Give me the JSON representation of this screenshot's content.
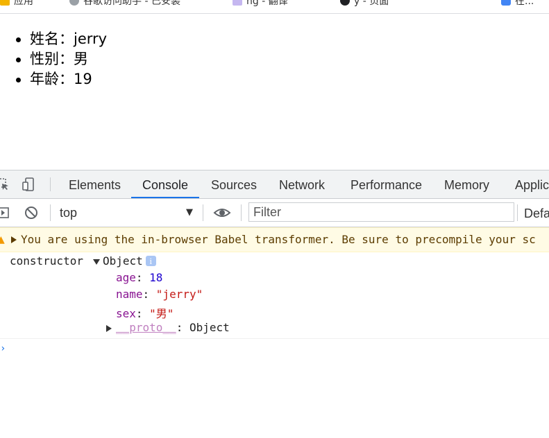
{
  "bookmarks": [
    {
      "label": "应用",
      "color": "#f4b400"
    },
    {
      "label": "谷歌访问助手 - 已安装",
      "color": "#9aa0a6"
    },
    {
      "label": "ng - 翻译",
      "color": "#c5b7f0"
    },
    {
      "label": "y - 页面",
      "color": "#202124"
    },
    {
      "label": "在...",
      "color": "#4285f4"
    }
  ],
  "page": {
    "items": [
      "姓名：jerry",
      "性别：男",
      "年龄：19"
    ]
  },
  "devtools": {
    "tabs": [
      "Elements",
      "Console",
      "Sources",
      "Network",
      "Performance",
      "Memory",
      "Applic"
    ],
    "active_tab": "Console",
    "context": "top",
    "filter_placeholder": "Filter",
    "levels_label": "Defa",
    "warning": "You are using the in-browser Babel transformer. Be sure to precompile your sc",
    "log": {
      "label": "constructor",
      "object_label": "Object",
      "info": "i",
      "props": [
        {
          "key": "age",
          "value": "18",
          "kind": "num"
        },
        {
          "key": "name",
          "value": "\"jerry\"",
          "kind": "str"
        },
        {
          "key": "sex",
          "value": "\"男\"",
          "kind": "str"
        }
      ],
      "proto_key": "__proto__",
      "proto_value": "Object"
    }
  },
  "colors": {
    "accent": "#1a73e8",
    "warning_bg": "#fffbe5",
    "prop_key": "#881391",
    "number": "#1c00cf",
    "string": "#c41a16"
  }
}
